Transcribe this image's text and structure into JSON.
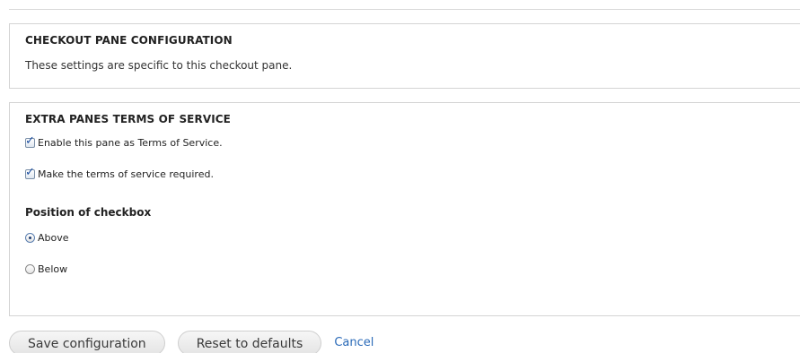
{
  "checkout_pane": {
    "legend": "CHECKOUT PANE CONFIGURATION",
    "description": "These settings are specific to this checkout pane."
  },
  "extra_panes": {
    "legend": "EXTRA PANES TERMS OF SERVICE",
    "checkboxes": [
      {
        "label": "Enable this pane as Terms of Service.",
        "checked": true
      },
      {
        "label": "Make the terms of service required.",
        "checked": true
      }
    ],
    "position": {
      "title": "Position of checkbox",
      "options": [
        {
          "label": "Above",
          "selected": true
        },
        {
          "label": "Below",
          "selected": false
        }
      ]
    }
  },
  "actions": {
    "save_label": "Save configuration",
    "reset_label": "Reset to defaults",
    "cancel_label": "Cancel"
  },
  "colors": {
    "link": "#2a6ab8",
    "border": "#d4d4d4",
    "checkmark": "#1d4fa1"
  }
}
